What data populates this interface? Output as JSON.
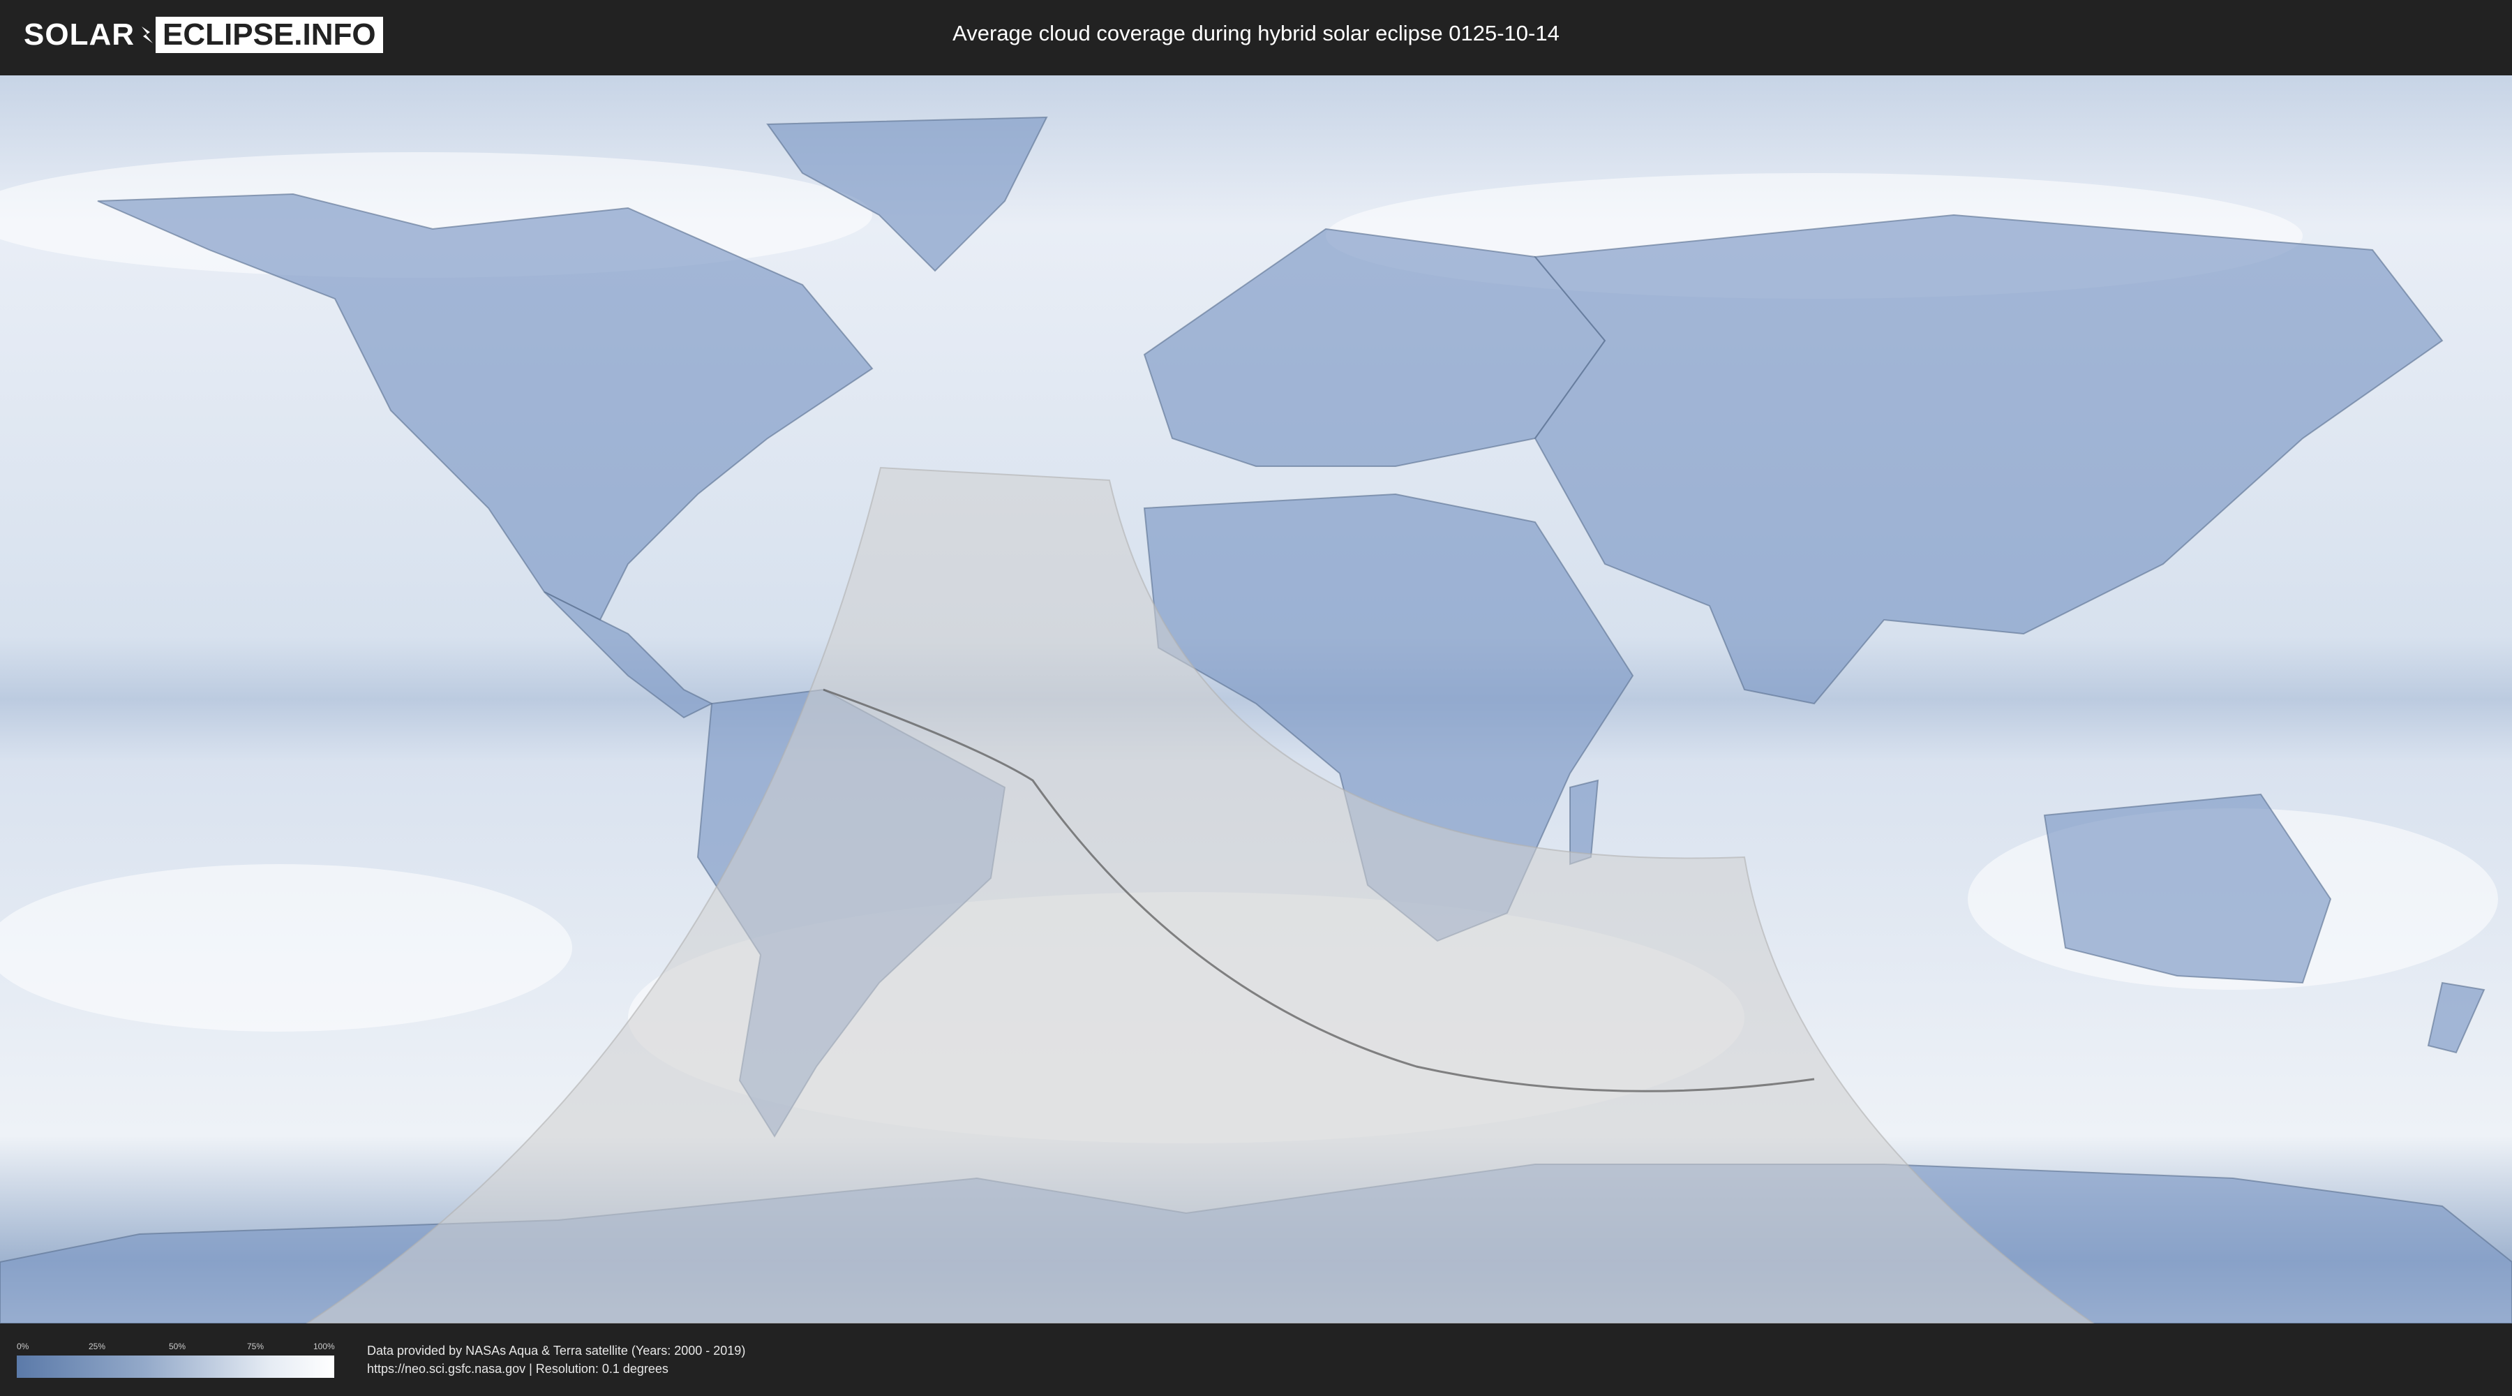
{
  "header": {
    "logo_left": "SOLAR",
    "logo_right": "ECLIPSE.INFO",
    "title": "Average cloud coverage during hybrid solar eclipse 0125-10-14"
  },
  "legend": {
    "ticks": [
      "0%",
      "25%",
      "50%",
      "75%",
      "100%"
    ],
    "colors": {
      "low": "#5b7aa9",
      "high": "#ffffff"
    }
  },
  "footer": {
    "credit_line1": "Data provided by NASAs Aqua & Terra satellite (Years: 2000 - 2019)",
    "credit_line2": "https://neo.sci.gsfc.nasa.gov | Resolution: 0.1 degrees"
  },
  "colors": {
    "background": "#222222",
    "ocean_cloud": "#eef3f9",
    "clear_land": "#6f8fbd",
    "eclipse_overlay": "#cfcfcf",
    "central_path": "#555555"
  }
}
